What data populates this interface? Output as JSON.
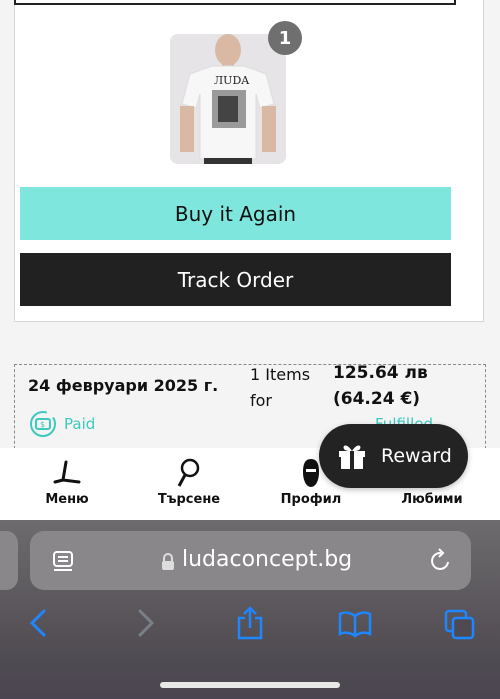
{
  "order_card": {
    "item_count_badge": "1",
    "buy_again_label": "Buy it Again",
    "track_order_label": "Track Order"
  },
  "order_summary": {
    "date": "24 февруари 2025 г.",
    "items_text": "1 Items for",
    "total_bgn": "125.64 лв",
    "total_eur": "(64.24 €)",
    "payment_status": "Paid",
    "fulfillment_status": "Fulfilled"
  },
  "reward": {
    "label": "Reward"
  },
  "bottom_nav": {
    "items": [
      {
        "label": "Меню",
        "icon": "menu-icon"
      },
      {
        "label": "Търсене",
        "icon": "search-icon"
      },
      {
        "label": "Профил",
        "icon": "profile-icon"
      },
      {
        "label": "Любими",
        "icon": "favorites-icon"
      }
    ]
  },
  "browser": {
    "url": "ludaconcept.bg"
  },
  "colors": {
    "accent": "#7fe6dd",
    "dark": "#212121",
    "status": "#3ec9bd"
  }
}
